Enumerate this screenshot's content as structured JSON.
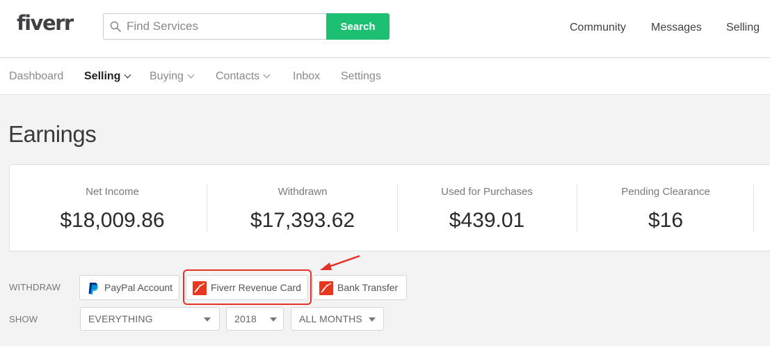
{
  "header": {
    "logo": "fiverr",
    "search_placeholder": "Find Services",
    "search_button": "Search",
    "nav": [
      "Community",
      "Messages",
      "Selling"
    ]
  },
  "subnav": {
    "items": [
      {
        "label": "Dashboard",
        "active": false,
        "dropdown": false
      },
      {
        "label": "Selling",
        "active": true,
        "dropdown": true
      },
      {
        "label": "Buying",
        "active": false,
        "dropdown": true
      },
      {
        "label": "Contacts",
        "active": false,
        "dropdown": true
      },
      {
        "label": "Inbox",
        "active": false,
        "dropdown": false
      },
      {
        "label": "Settings",
        "active": false,
        "dropdown": false
      }
    ]
  },
  "page_title": "Earnings",
  "stats": [
    {
      "label": "Net Income",
      "value": "$18,009.86"
    },
    {
      "label": "Withdrawn",
      "value": "$17,393.62"
    },
    {
      "label": "Used for Purchases",
      "value": "$439.01"
    },
    {
      "label": "Pending Clearance",
      "value": "$16"
    }
  ],
  "withdraw": {
    "label": "WITHDRAW",
    "options": [
      {
        "label": "PayPal Account",
        "icon": "paypal-icon"
      },
      {
        "label": "Fiverr Revenue Card",
        "icon": "revenue-card-icon"
      },
      {
        "label": "Bank Transfer",
        "icon": "bank-transfer-icon"
      }
    ]
  },
  "show": {
    "label": "SHOW",
    "filters": [
      {
        "value": "EVERYTHING"
      },
      {
        "value": "2018"
      },
      {
        "value": "ALL MONTHS"
      }
    ]
  },
  "colors": {
    "brand_green": "#1dbf73",
    "annotation_red": "#e53126",
    "card_orange": "#e8371f"
  }
}
